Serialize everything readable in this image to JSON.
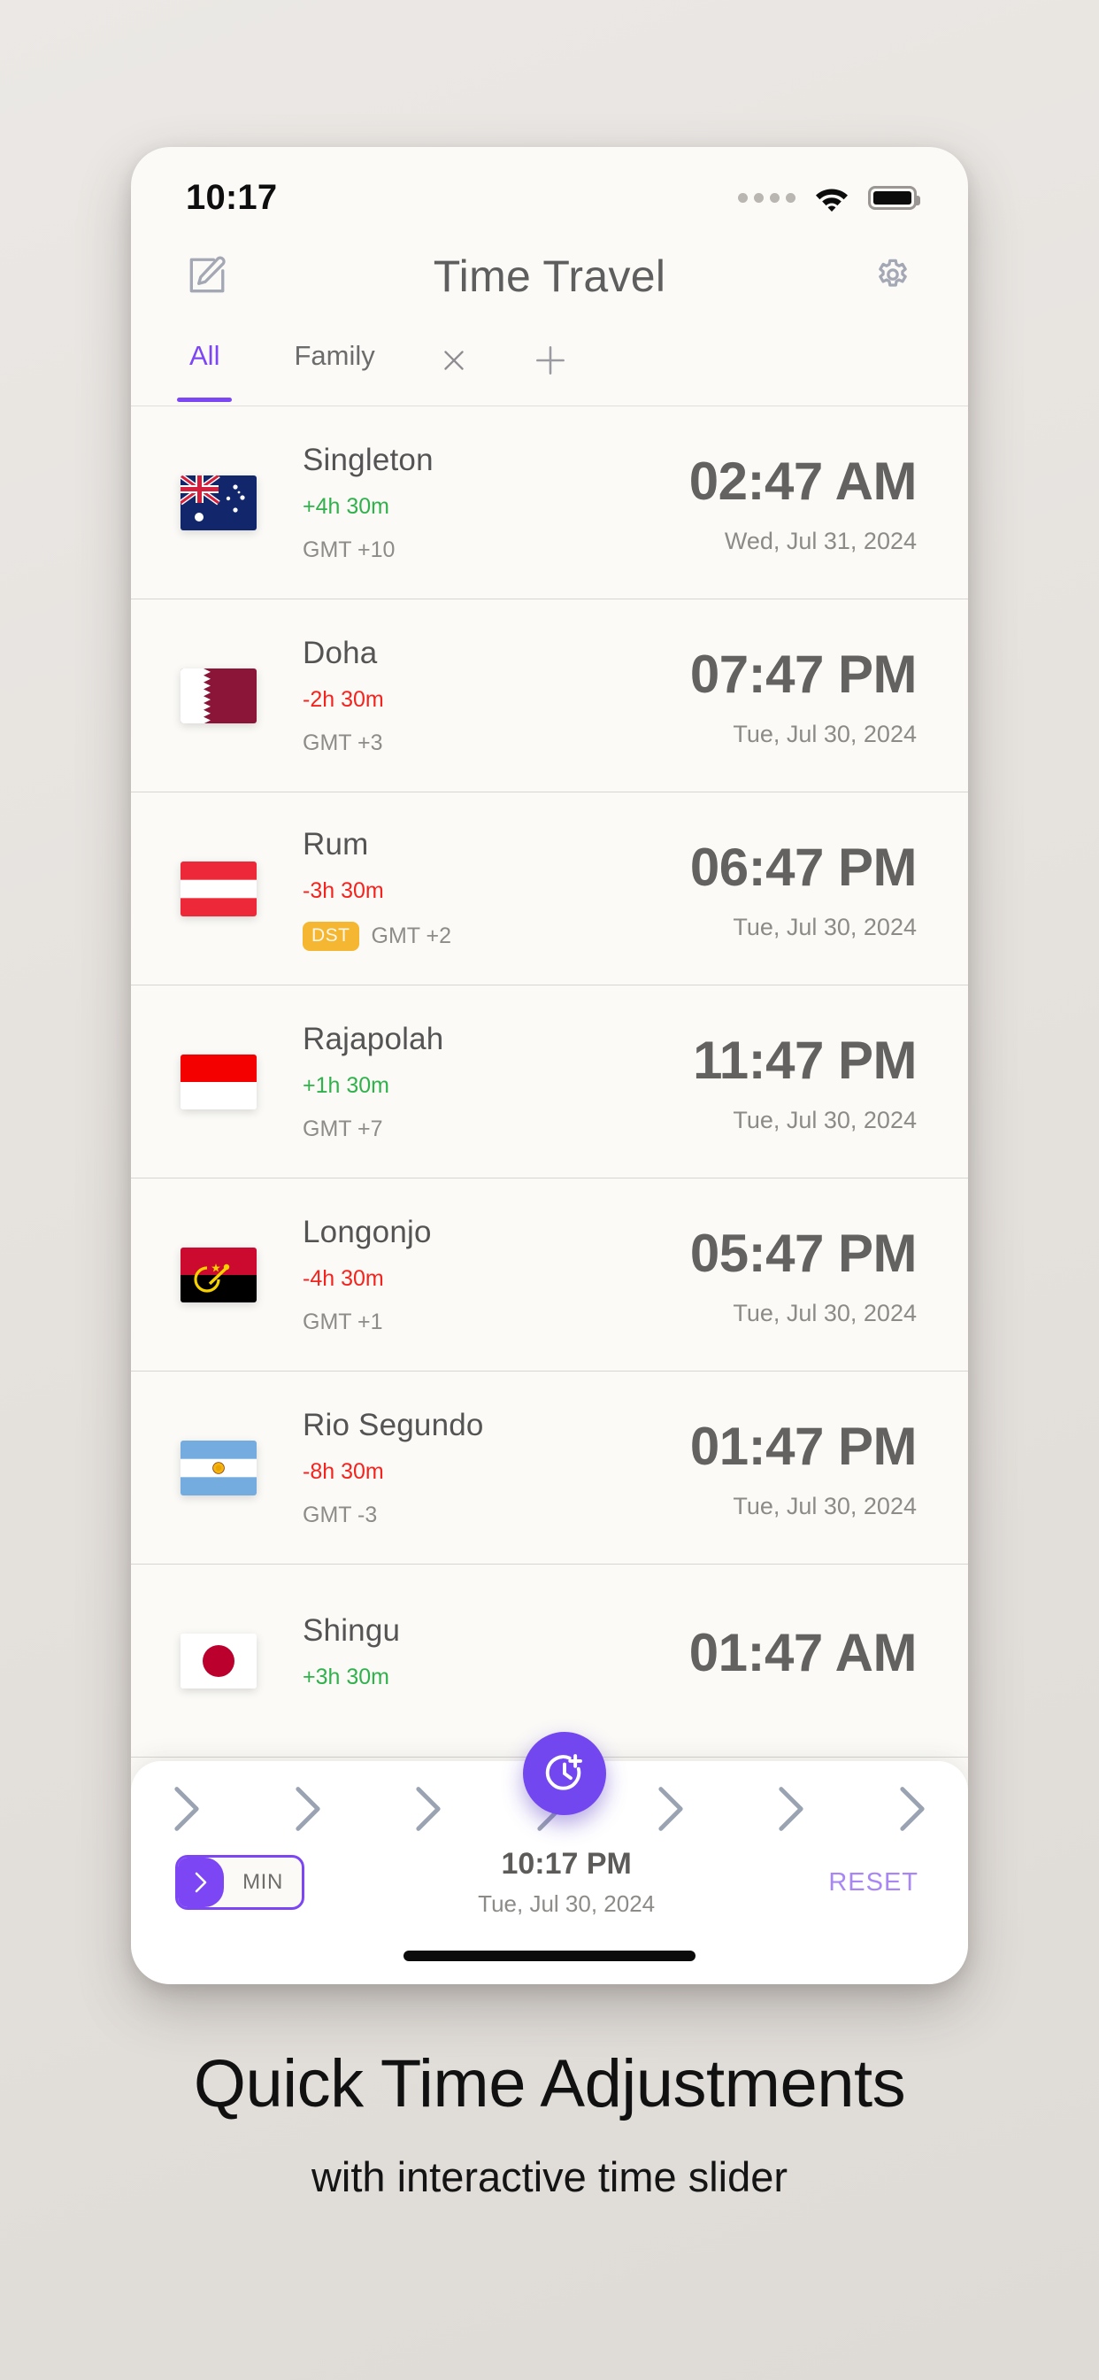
{
  "status_bar": {
    "time": "10:17",
    "signal_icon": "signal-dots-icon",
    "wifi_icon": "wifi-icon",
    "battery_icon": "battery-icon"
  },
  "app_bar": {
    "edit_icon": "edit-compose-icon",
    "title": "Time Travel",
    "settings_icon": "gear-icon"
  },
  "tabs": {
    "items": [
      {
        "label": "All",
        "active": true
      },
      {
        "label": "Family",
        "active": false
      }
    ],
    "close_icon": "close-x-icon",
    "add_icon": "plus-icon"
  },
  "cities": [
    {
      "name": "Singleton",
      "offset": "+4h 30m",
      "offset_sign": "pos",
      "gmt": "GMT +10",
      "dst": null,
      "time": "02:47 AM",
      "date": "Wed, Jul 31, 2024",
      "flag": "australia-flag"
    },
    {
      "name": "Doha",
      "offset": "-2h 30m",
      "offset_sign": "neg",
      "gmt": "GMT +3",
      "dst": null,
      "time": "07:47 PM",
      "date": "Tue, Jul 30, 2024",
      "flag": "qatar-flag"
    },
    {
      "name": "Rum",
      "offset": "-3h 30m",
      "offset_sign": "neg",
      "gmt": "GMT +2",
      "dst": "DST",
      "time": "06:47 PM",
      "date": "Tue, Jul 30, 2024",
      "flag": "austria-flag"
    },
    {
      "name": "Rajapolah",
      "offset": "+1h 30m",
      "offset_sign": "pos",
      "gmt": "GMT +7",
      "dst": null,
      "time": "11:47 PM",
      "date": "Tue, Jul 30, 2024",
      "flag": "indonesia-flag"
    },
    {
      "name": "Longonjo",
      "offset": "-4h 30m",
      "offset_sign": "neg",
      "gmt": "GMT +1",
      "dst": null,
      "time": "05:47 PM",
      "date": "Tue, Jul 30, 2024",
      "flag": "angola-flag"
    },
    {
      "name": "Rio Segundo",
      "offset": "-8h 30m",
      "offset_sign": "neg",
      "gmt": "GMT -3",
      "dst": null,
      "time": "01:47 PM",
      "date": "Tue, Jul 30, 2024",
      "flag": "argentina-flag"
    },
    {
      "name": "Shingu",
      "offset": "+3h 30m",
      "offset_sign": "pos",
      "gmt": "",
      "dst": null,
      "time": "01:47 AM",
      "date": "",
      "flag": "japan-flag"
    }
  ],
  "fab": {
    "icon": "clock-plus-icon"
  },
  "slider_panel": {
    "chevron_icon": "chevron-right-icon",
    "chevron_count": 7,
    "unit_toggle": {
      "label": "MIN",
      "knob_icon": "chevron-right-icon"
    },
    "current_time": "10:17 PM",
    "current_date": "Tue, Jul 30, 2024",
    "reset_label": "RESET"
  },
  "caption": {
    "headline": "Quick Time Adjustments",
    "subhead": "with interactive time slider"
  },
  "colors": {
    "accent": "#7c46f5",
    "fab": "#7247f0",
    "positive": "#2fb14b",
    "negative": "#f4231e",
    "dst_badge": "#f5b731",
    "reset": "#a887f5"
  }
}
